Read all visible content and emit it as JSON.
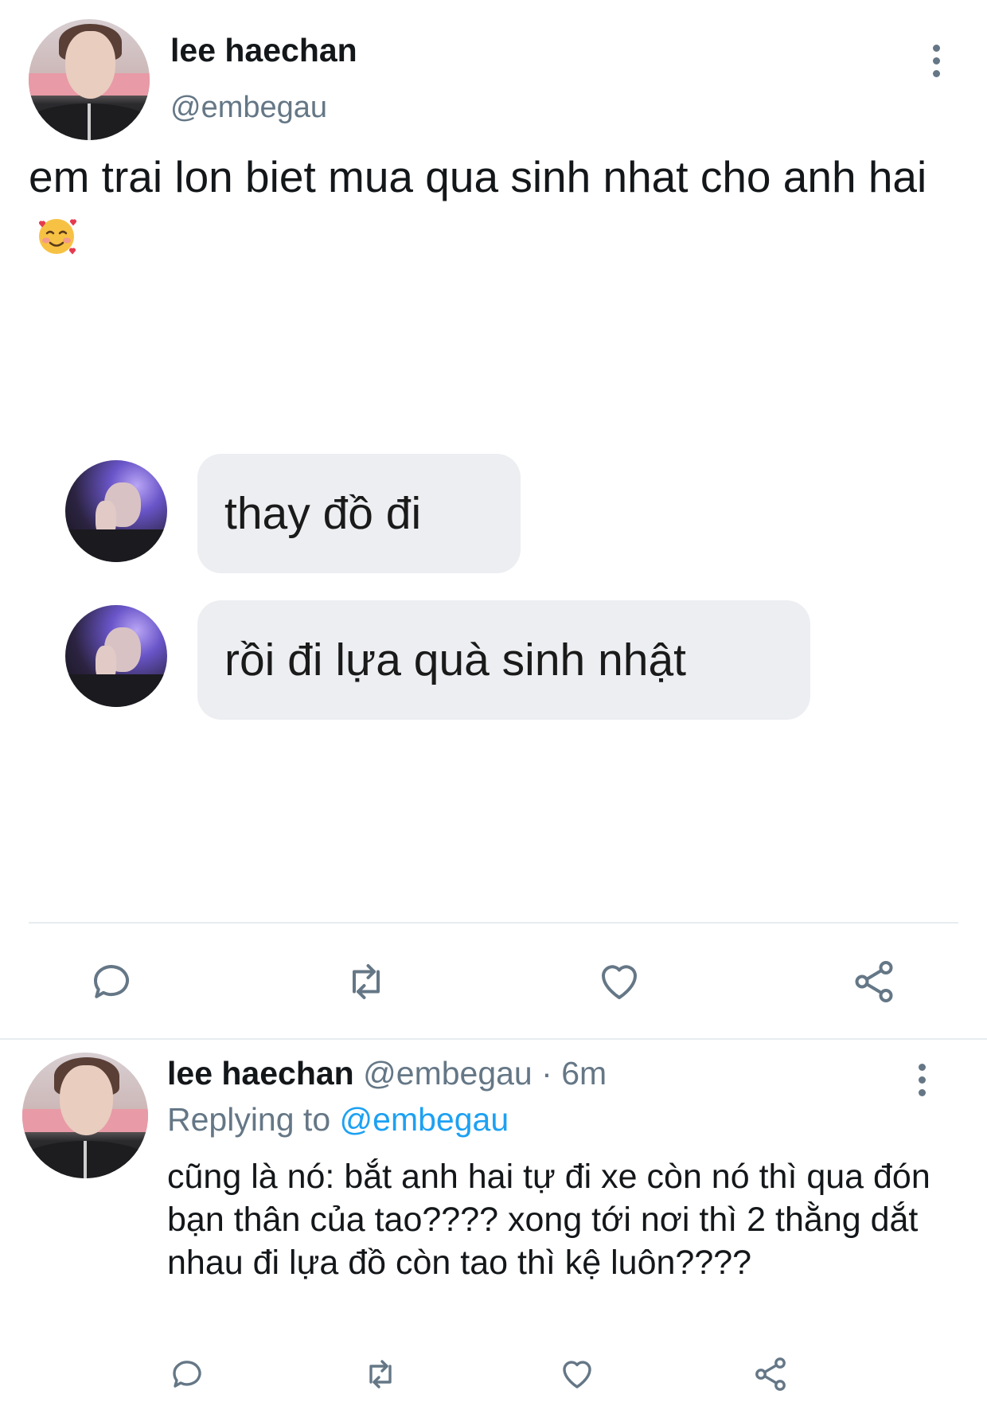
{
  "tweet": {
    "author_name": "lee haechan",
    "author_handle": "@embegau",
    "text": "em trai lon biet mua qua sinh nhat cho anh hai",
    "emoji": "smiling-face-with-hearts",
    "menu_icon": "more-vertical-icon"
  },
  "image": {
    "messages": [
      {
        "text": "thay đồ đi"
      },
      {
        "text": "rồi đi lựa quà sinh nhật"
      }
    ]
  },
  "tweet_actions": [
    {
      "name": "reply",
      "icon": "reply-icon"
    },
    {
      "name": "retweet",
      "icon": "retweet-icon"
    },
    {
      "name": "like",
      "icon": "heart-icon"
    },
    {
      "name": "share",
      "icon": "share-icon"
    }
  ],
  "reply": {
    "author_name": "lee haechan",
    "author_handle": "@embegau",
    "separator": "·",
    "time": "6m",
    "replying_label": "Replying to",
    "replying_handle": "@embegau",
    "text": "cũng là nó: bắt anh hai tự đi xe còn nó thì qua đón bạn thân của tao???? xong tới nơi thì 2 thằng dắt nhau đi lựa đồ còn tao thì kệ luôn????"
  },
  "colors": {
    "text": "#14171a",
    "secondary": "#657786",
    "link": "#1da1f2",
    "bubble": "#eceef1",
    "divider": "#e6ecf0"
  }
}
